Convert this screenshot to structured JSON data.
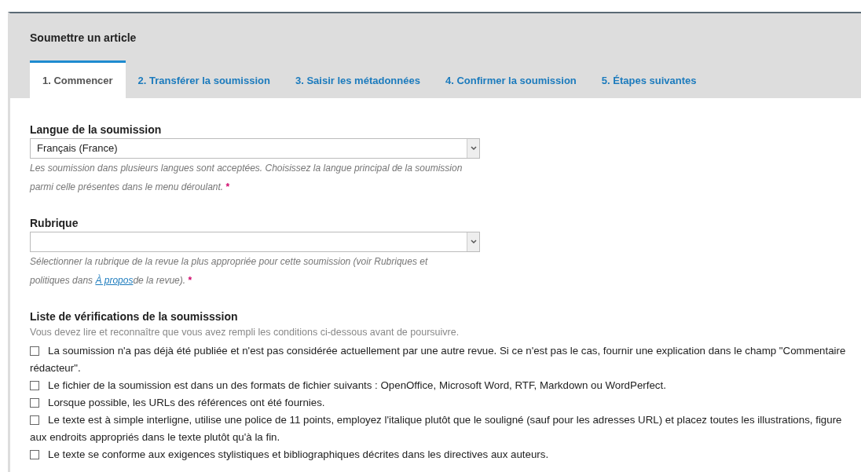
{
  "page_title": "Soumettre un article",
  "tabs": [
    {
      "label": "1. Commencer",
      "selected": true
    },
    {
      "label": "2. Transférer la soumission",
      "selected": false
    },
    {
      "label": "3. Saisir les métadonnées",
      "selected": false
    },
    {
      "label": "4. Confirmer la soumission",
      "selected": false
    },
    {
      "label": "5. Étapes suivantes",
      "selected": false
    }
  ],
  "fields": [
    {
      "label": "Langue de la soumission",
      "value": "Français (France)",
      "help": "Les soumission dans plusieurs langues sont acceptées. Choisissez la langue principal de la soumission parmi celle présentes dans le menu déroulant.",
      "required_mark": "*"
    },
    {
      "label": "Rubrique",
      "help": "Sélectionner la rubrique de la revue la plus appropriée pour cette soumission (voir Rubriques et politiques dans ",
      "help_link": "À propos",
      "help_after": "de la revue).",
      "required_mark": "*"
    }
  ],
  "checklist": {
    "title": "Liste de vérifications de la soumisssion",
    "intro": "Vous devez lire et reconnaître que vous avez rempli les conditions ci-dessous avant de poursuivre.",
    "items": [
      {
        "checked": false,
        "lines": [
          "La soumission n'a pas déjà été publiée et n'est pas considérée actuellement par une autre revue. Si ce n'est pas le cas, fournir une explication dans le champ \"Commentaire",
          "rédacteur\"."
        ]
      },
      {
        "checked": false,
        "lines": [
          "Le fichier de la soumission est dans un des formats de fichier suivants : OpenOffice, Microsoft Word, RTF, Markdown ou WordPerfect."
        ]
      },
      {
        "checked": false,
        "lines": [
          "Lorsque possible, les URLs des références ont été fournies."
        ]
      },
      {
        "checked": false,
        "lines": [
          "Le texte est à simple interligne, utilise une police de 11 points, employez l'italique plutôt que le souligné (sauf pour les adresses URL) et placez toutes les illustrations, figure",
          "aux endroits appropriés dans le texte plutôt qu'à la fin."
        ]
      },
      {
        "checked": false,
        "lines": [
          "Le texte se conforme aux exigences stylistiques et bibliographiques décrites dans les directives aux auteurs."
        ]
      }
    ]
  }
}
